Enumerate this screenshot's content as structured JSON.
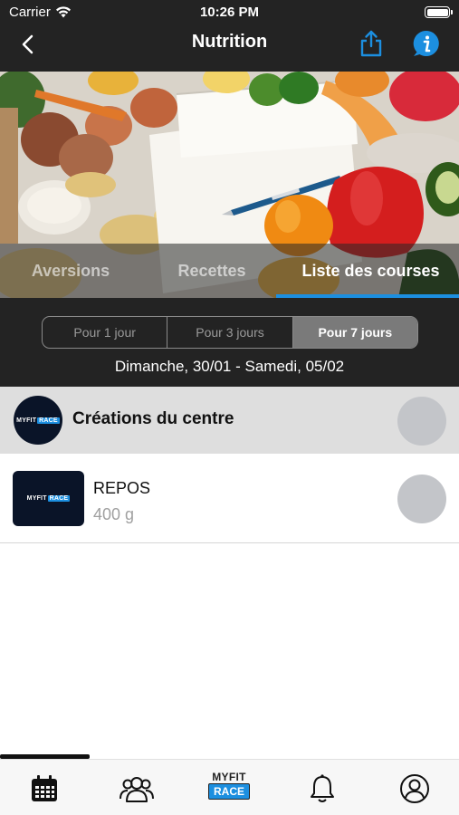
{
  "status_bar": {
    "carrier": "Carrier",
    "time": "10:26 PM"
  },
  "nav": {
    "title": "Nutrition",
    "back_icon": "chevron-left-icon",
    "share_icon": "share-icon",
    "info_icon": "info-icon"
  },
  "tabs": [
    {
      "label": "Aversions",
      "active": false
    },
    {
      "label": "Recettes",
      "active": false
    },
    {
      "label": "Liste des courses",
      "active": true
    }
  ],
  "period": {
    "options": [
      "Pour 1 jour",
      "Pour 3 jours",
      "Pour 7 jours"
    ],
    "selected": "Pour 7 jours",
    "date_range": "Dimanche, 30/01 - Samedi, 05/02"
  },
  "section": {
    "title": "Créations du centre"
  },
  "items": [
    {
      "name": "REPOS",
      "quantity": "400 g"
    }
  ],
  "logo": {
    "brand_top": "MYFIT",
    "brand_bottom": "RACE",
    "mini_left": "MYFIT",
    "mini_right": "RACE"
  },
  "tab_bar": {
    "icons": [
      "calendar-icon",
      "users-icon",
      "myfit-race-logo",
      "bell-icon",
      "profile-icon"
    ]
  },
  "colors": {
    "accent": "#1c8fe0",
    "dark": "#232323",
    "section_bg": "#dedede",
    "check_gray": "#c3c5c9"
  }
}
